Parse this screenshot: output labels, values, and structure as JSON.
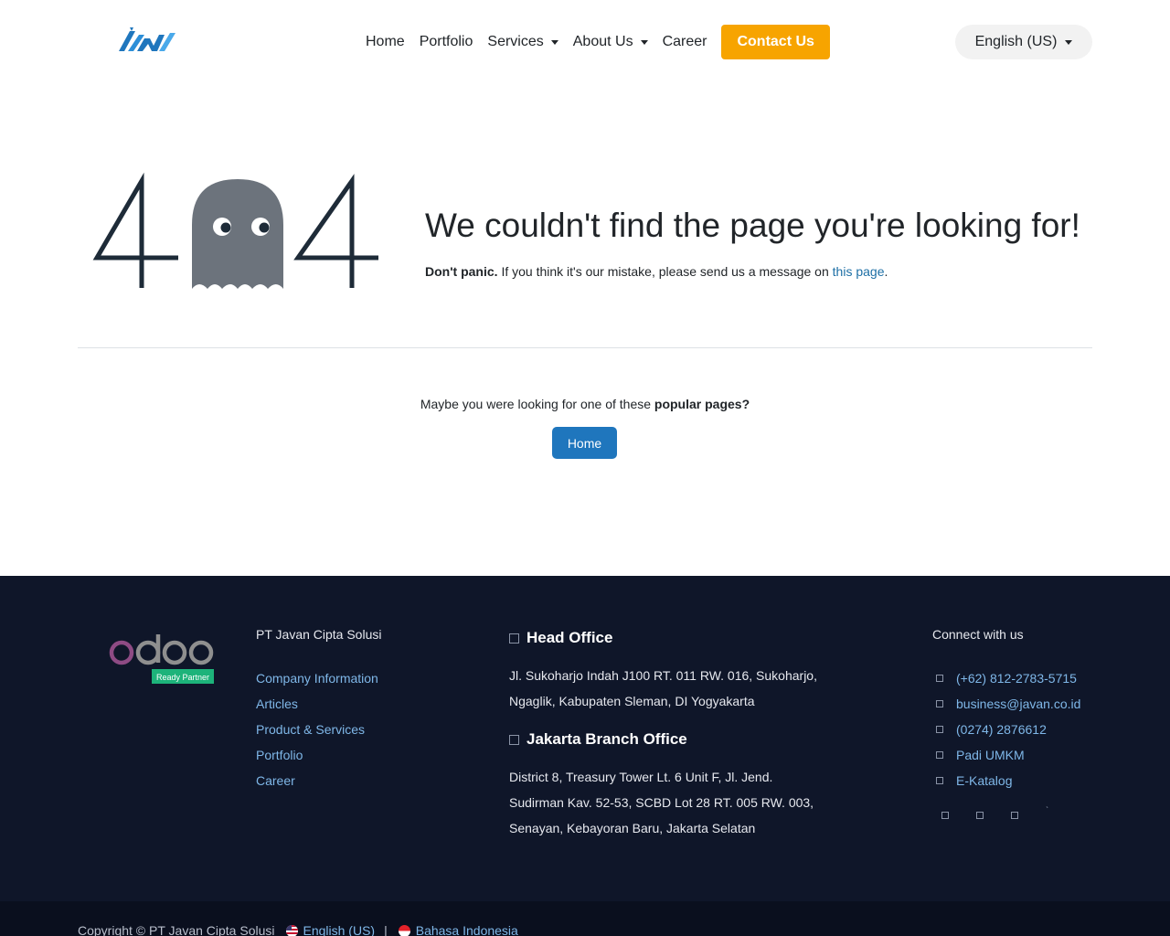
{
  "header": {
    "nav": {
      "home": "Home",
      "portfolio": "Portfolio",
      "services": "Services",
      "about": "About Us",
      "career": "Career"
    },
    "contact_label": "Contact Us",
    "language": "English (US)"
  },
  "error": {
    "title": "We couldn't find the page you're looking for!",
    "sub_bold": "Don't panic.",
    "sub_text": " If you think it's our mistake, please send us a message on ",
    "sub_link": "this page",
    "sub_end": ".",
    "popular_prefix": "Maybe you were looking for one of these ",
    "popular_bold": "popular pages?",
    "home_button": "Home"
  },
  "footer": {
    "company_title": "PT Javan Cipta Solusi",
    "links": [
      "Company Information",
      "Articles",
      "Product & Services",
      "Portfolio",
      "Career"
    ],
    "head_office_title": "Head Office",
    "head_office_addr": [
      "Jl. Sukoharjo Indah J100 RT. 011 RW. 016, Sukoharjo,",
      "Ngaglik, Kabupaten Sleman, DI Yogyakarta"
    ],
    "branch_title": "Jakarta Branch Office",
    "branch_addr": [
      "District 8, Treasury Tower Lt. 6 Unit F, Jl. Jend.",
      "Sudirman Kav. 52-53, SCBD Lot 28 RT. 005 RW. 003,",
      "Senayan, Kebayoran Baru, Jakarta Selatan"
    ],
    "connect_title": "Connect with us",
    "contacts": [
      "(+62) 812-2783-5715",
      "business@javan.co.id",
      "(0274) 2876612",
      "Padi UMKM",
      "E-Katalog"
    ],
    "odoo_badge": "Ready Partner"
  },
  "copyright": {
    "text": "Copyright © PT Javan Cipta Solusi",
    "lang_en": "English (US)",
    "separator": "|",
    "lang_id": "Bahasa Indonesia"
  },
  "colors": {
    "accent_orange": "#f7a400",
    "primary_blue": "#1f76bd",
    "footer_bg": "#0f1629"
  }
}
